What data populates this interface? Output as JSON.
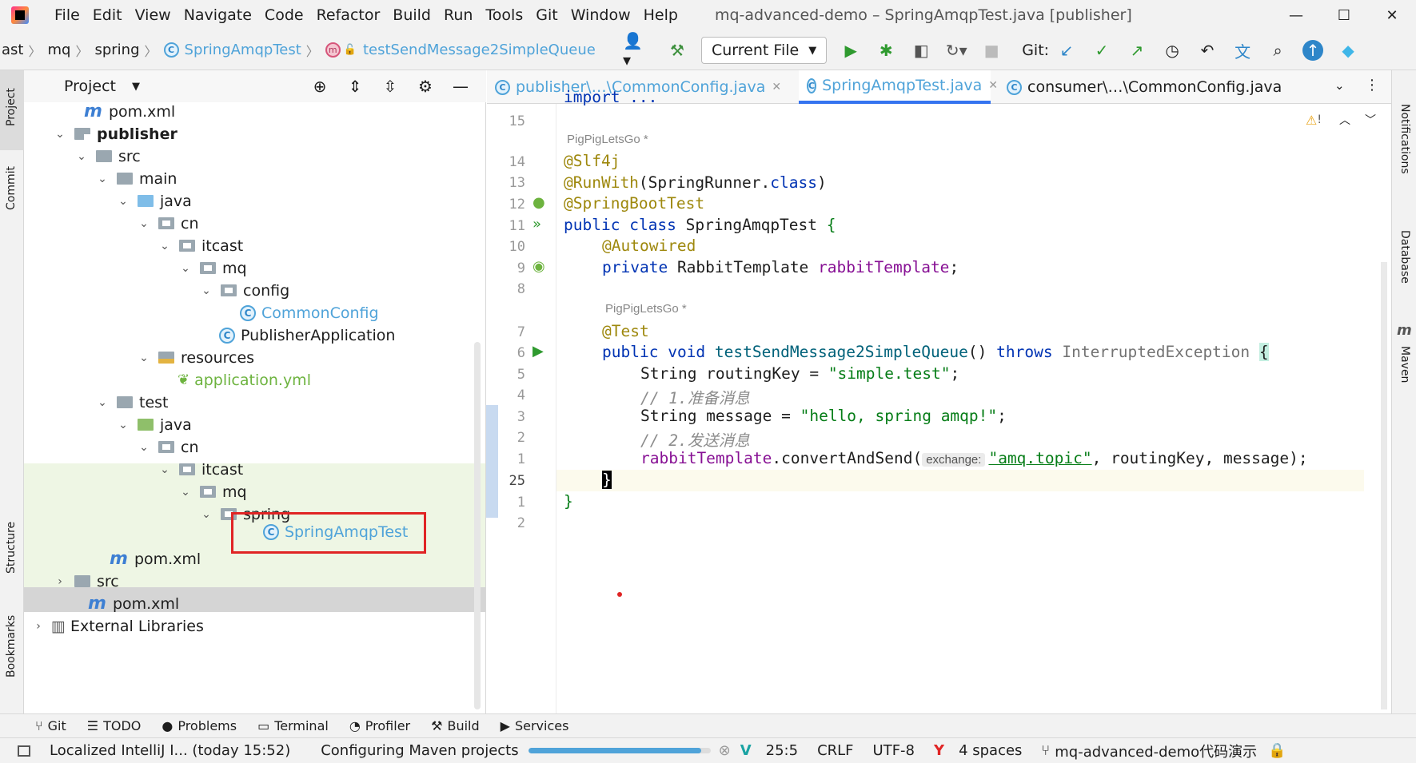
{
  "titlebar": {
    "menus": [
      "File",
      "Edit",
      "View",
      "Navigate",
      "Code",
      "Refactor",
      "Build",
      "Run",
      "Tools",
      "Git",
      "Window",
      "Help"
    ],
    "title": "mq-advanced-demo – SpringAmqpTest.java [publisher]"
  },
  "navbar": {
    "breadcrumbs": [
      "ast",
      "mq",
      "spring",
      "SpringAmqpTest",
      "testSendMessage2SimpleQueue"
    ],
    "run_config": "Current File",
    "git_label": "Git:"
  },
  "project_panel": {
    "title": "Project",
    "tree": [
      {
        "label": "pom.xml",
        "kind": "maven"
      },
      {
        "label": "publisher",
        "kind": "module"
      },
      {
        "label": "src",
        "kind": "folder"
      },
      {
        "label": "main",
        "kind": "folder"
      },
      {
        "label": "java",
        "kind": "src-folder"
      },
      {
        "label": "cn",
        "kind": "package"
      },
      {
        "label": "itcast",
        "kind": "package"
      },
      {
        "label": "mq",
        "kind": "package"
      },
      {
        "label": "config",
        "kind": "package"
      },
      {
        "label": "CommonConfig",
        "kind": "class"
      },
      {
        "label": "PublisherApplication",
        "kind": "class"
      },
      {
        "label": "resources",
        "kind": "res-folder"
      },
      {
        "label": "application.yml",
        "kind": "yml"
      },
      {
        "label": "test",
        "kind": "folder"
      },
      {
        "label": "java",
        "kind": "test-folder"
      },
      {
        "label": "cn",
        "kind": "package"
      },
      {
        "label": "itcast",
        "kind": "package"
      },
      {
        "label": "mq",
        "kind": "package"
      },
      {
        "label": "spring",
        "kind": "package"
      },
      {
        "label": "SpringAmqpTest",
        "kind": "class"
      },
      {
        "label": "pom.xml",
        "kind": "maven"
      },
      {
        "label": "src",
        "kind": "folder"
      },
      {
        "label": "pom.xml",
        "kind": "maven"
      },
      {
        "label": "External Libraries",
        "kind": "libs"
      }
    ]
  },
  "editor": {
    "tabs": [
      "publisher\\…\\CommonConfig.java",
      "SpringAmqpTest.java",
      "consumer\\…\\CommonConfig.java"
    ],
    "active_tab": "SpringAmqpTest.java",
    "author": "PigPigLetsGo *",
    "lines": {
      "l_import": "import ...",
      "n15": "15",
      "n14": "14",
      "n13": "13",
      "n12": "12",
      "n11": "11",
      "n10": "10",
      "n9": "9",
      "n8": "8",
      "n7": "7",
      "n6": "6",
      "n5": "5",
      "n4": "4",
      "n3": "3",
      "n2": "2",
      "n1": "1",
      "n25": "25",
      "n1b": "1",
      "n2b": "2",
      "a_slf4j": "@Slf4j",
      "a_runwith": "@RunWith",
      "runwith_arg": "(SpringRunner.",
      "kw_class": "class",
      "close_paren": ")",
      "a_sbt": "@SpringBootTest",
      "kw_public": "public",
      "kw_class2": "class",
      "cls_name": "SpringAmqpTest",
      "brace_open": "{",
      "a_autowired": "@Autowired",
      "kw_private": "private",
      "type_rt": "RabbitTemplate",
      "fld_rt": "rabbitTemplate",
      "semi": ";",
      "a_test": "@Test",
      "kw_public2": "public",
      "kw_void": "void",
      "m_name": "testSendMessage2SimpleQueue",
      "parens": "()",
      "kw_throws": "throws",
      "exc": "InterruptedException",
      "brace2": "{",
      "l5_a": "String routingKey = ",
      "l5_str": "\"simple.test\"",
      "c1": "// 1.准备消息",
      "l3_a": "String message = ",
      "l3_str": "\"hello, spring amqp!\"",
      "c2": "// 2.发送消息",
      "l1_fld": "rabbitTemplate",
      "l1_call": ".convertAndSend(",
      "hint": "exchange:",
      "l1_str": "\"amq.topic\"",
      "l1_rest": ", routingKey, message);",
      "close1": "}",
      "close2": "}"
    }
  },
  "side_labels": {
    "project": "Project",
    "commit": "Commit",
    "structure": "Structure",
    "bookmarks": "Bookmarks",
    "notifications": "Notifications",
    "database": "Database",
    "maven": "Maven"
  },
  "bottom_tools": [
    "Git",
    "TODO",
    "Problems",
    "Terminal",
    "Profiler",
    "Build",
    "Services"
  ],
  "status": {
    "left_msg": "Localized IntelliJ I... (today 15:52)",
    "progress_msg": "Configuring Maven projects",
    "progress": 0.95,
    "position": "25:5",
    "line_sep": "CRLF",
    "encoding": "UTF-8",
    "indent": "4 spaces",
    "branch": "mq-advanced-demo代码演示"
  },
  "colors": {
    "accent": "#2e86c9",
    "highlight_box": "#e02424"
  }
}
